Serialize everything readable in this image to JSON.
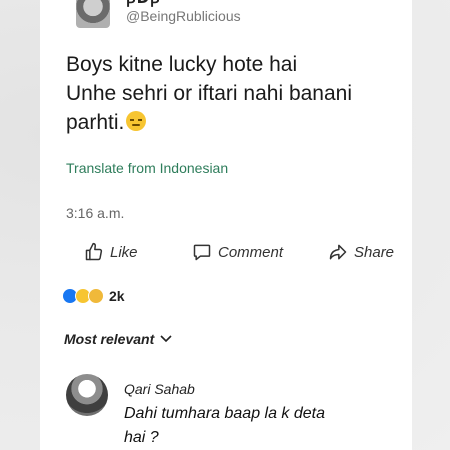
{
  "post": {
    "author_fragment": "ꞴDꞴ",
    "handle": "@BeingRublicious",
    "text_lines": [
      "Boys kitne lucky hote hai",
      "Unhe sehri or iftari nahi banani",
      "parhti."
    ],
    "translate_link": "Translate from Indonesian",
    "timestamp": "3:16 a.m."
  },
  "actions": {
    "like": "Like",
    "comment": "Comment",
    "share": "Share"
  },
  "reactions": {
    "count": "2k",
    "icons": [
      "like-reaction-icon",
      "haha-reaction-icon",
      "sad-reaction-icon"
    ]
  },
  "comments": {
    "sort_label": "Most relevant",
    "items": [
      {
        "author": "Qari Sahab",
        "text_lines": [
          "Dahi tumhara baap la k deta",
          "hai ?"
        ]
      }
    ]
  },
  "colors": {
    "translate_link": "#2e7d5b",
    "like_reaction": "#1877f2",
    "emoji_yellow": "#f7c531"
  }
}
